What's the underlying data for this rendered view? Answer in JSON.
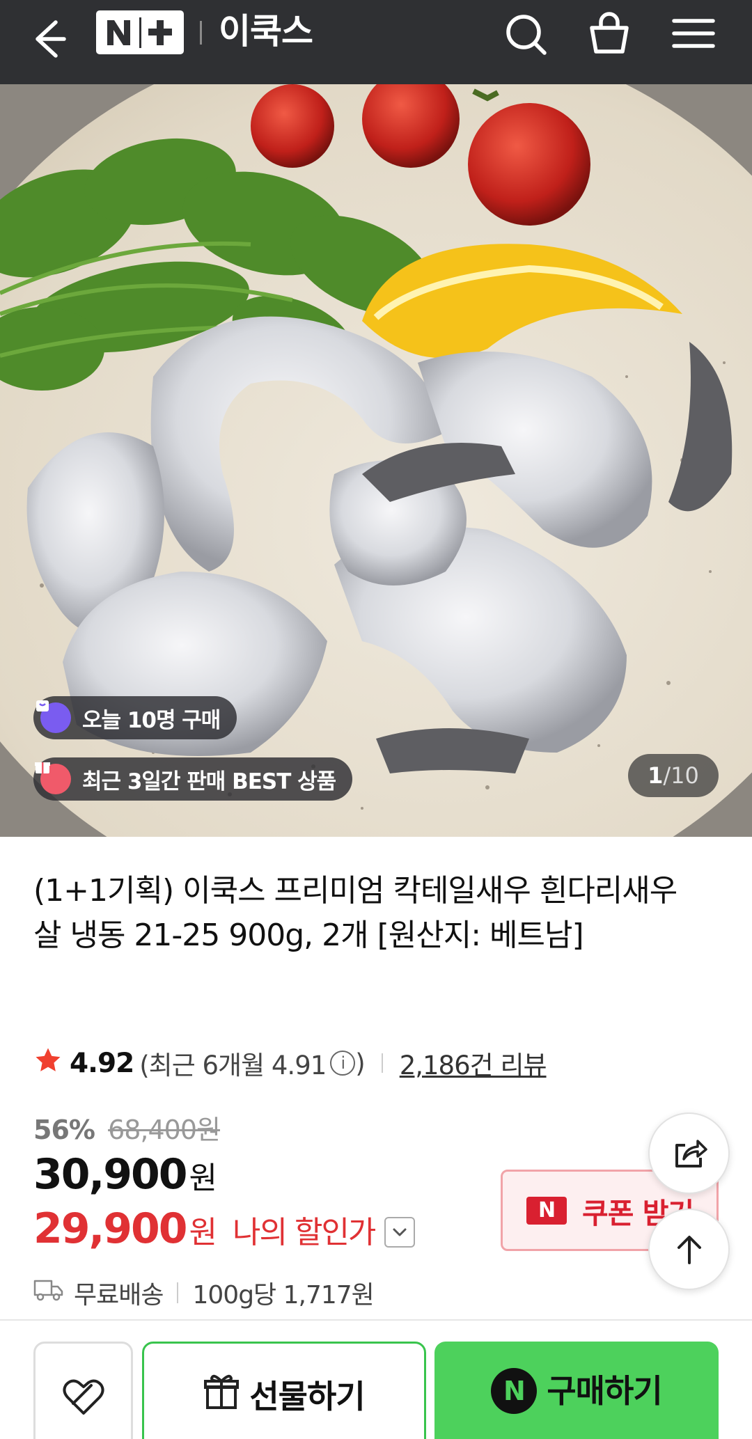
{
  "header": {
    "logo_text": "N+",
    "store_name": "이쿡스"
  },
  "hero": {
    "badges": [
      {
        "text": "오늘 10명 구매"
      },
      {
        "text": "최근 3일간 판매 BEST 상품"
      }
    ],
    "counter": {
      "current": "1",
      "total": "/10"
    }
  },
  "product": {
    "title": "(1+1기획) 이쿡스 프리미엄 칵테일새우 흰다리새우살 냉동 21-25 900g, 2개 [원산지: 베트남]",
    "rating": "4.92",
    "recent_rating_open": "(최근 6개월 4.91",
    "recent_rating_close": ")",
    "info_glyph": "i",
    "reviews": "2,186건 리뷰",
    "discount_pct": "56%",
    "original_price": "68,400원",
    "price": "30,900",
    "price_unit": "원",
    "my_price": "29,900",
    "my_price_unit": "원",
    "my_price_label": "나의 할인가",
    "delivery": "무료배송",
    "unit_price": "100g당 1,717원"
  },
  "coupon": {
    "badge": "N",
    "label": "쿠폰 받기"
  },
  "bottom": {
    "gift_label": "선물하기",
    "buy_label": "구매하기",
    "buy_logo": "N"
  },
  "colors": {
    "header_bg": "#2f3033",
    "accent_red": "#e03134",
    "buy_green": "#4dd15c"
  }
}
